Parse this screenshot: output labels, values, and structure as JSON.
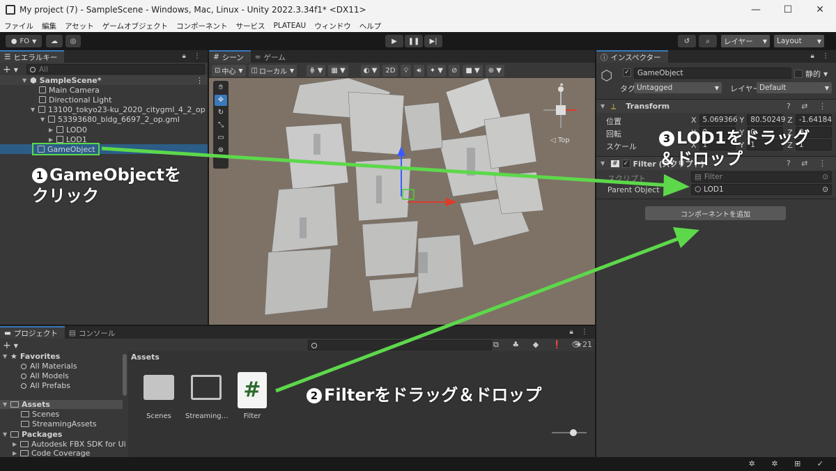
{
  "window": {
    "title": "My project (7) - SampleScene - Windows, Mac, Linux - Unity 2022.3.34f1* <DX11>",
    "controls": [
      "—",
      "☐",
      "✕"
    ]
  },
  "menu": [
    "ファイル",
    "編集",
    "アセット",
    "ゲームオブジェクト",
    "コンポーネント",
    "サービス",
    "PLATEAU",
    "ウィンドウ",
    "ヘルプ"
  ],
  "toolbar": {
    "account": "FO",
    "layers": "レイヤー",
    "layout": "Layout"
  },
  "hierarchy": {
    "tab": "ヒエラルキー",
    "search_placeholder": "All",
    "rows": [
      {
        "label": "SampleScene*",
        "depth": 0
      },
      {
        "label": "Main Camera",
        "depth": 1
      },
      {
        "label": "Directional Light",
        "depth": 1
      },
      {
        "label": "13100_tokyo23-ku_2020_citygml_4_2_op",
        "depth": 1
      },
      {
        "label": "53393680_bldg_6697_2_op.gml",
        "depth": 2
      },
      {
        "label": "LOD0",
        "depth": 3
      },
      {
        "label": "LOD1",
        "depth": 3
      },
      {
        "label": "GameObject",
        "depth": 1
      }
    ]
  },
  "scene": {
    "tabs": [
      "シーン",
      "ゲーム"
    ],
    "pivot": "中心",
    "space": "ローカル",
    "mode2d": "2D",
    "gizmo_label": "Top"
  },
  "inspector": {
    "tab": "インスペクター",
    "object_name": "GameObject",
    "static_label": "静的",
    "tag_label": "タグ",
    "tag_value": "Untagged",
    "layer_label": "レイヤー",
    "layer_value": "Default",
    "transform": {
      "title": "Transform",
      "position_label": "位置",
      "rotation_label": "回転",
      "scale_label": "スケール",
      "pos_x": "5.069366",
      "pos_y": "80.50249",
      "pos_z": "-1.64184",
      "rot_x": "0",
      "rot_y": "0",
      "rot_z": "0",
      "scale_x": "1",
      "scale_y": "1",
      "scale_z": "1"
    },
    "filter": {
      "title": "Filter (スクリプト)",
      "script_label": "スクリプト",
      "script_value": "Filter",
      "parent_label": "Parent Object",
      "parent_value": "LOD1"
    },
    "add_component": "コンポーネントを追加"
  },
  "project": {
    "tabs": [
      "プロジェクト",
      "コンソール"
    ],
    "favorites_label": "Favorites",
    "favorites": [
      "All Materials",
      "All Models",
      "All Prefabs"
    ],
    "assets_label": "Assets",
    "assets_children": [
      "Scenes",
      "StreamingAssets"
    ],
    "packages_label": "Packages",
    "packages_children": [
      "Autodesk FBX SDK for Ui",
      "Code Coverage"
    ],
    "breadcrumb": "Assets",
    "items": [
      {
        "label": "Scenes",
        "kind": "folder"
      },
      {
        "label": "Streaming…",
        "kind": "folder-open"
      },
      {
        "label": "Filter",
        "kind": "script"
      }
    ],
    "count": "21"
  },
  "annotations": {
    "step1_num": "1",
    "step1_line1": "GameObjectを",
    "step1_line2": "クリック",
    "step2_num": "2",
    "step2_text": "Filterをドラッグ＆ドロップ",
    "step3_num": "3",
    "step3_line1": "LOD1をドラッグ",
    "step3_line2": "＆ドロップ"
  },
  "colors": {
    "annotation_arrow": "#5dd84b",
    "selection": "#2c5d87",
    "scene_bg": "#7e7266",
    "tab_accent": "#3a79bb"
  }
}
